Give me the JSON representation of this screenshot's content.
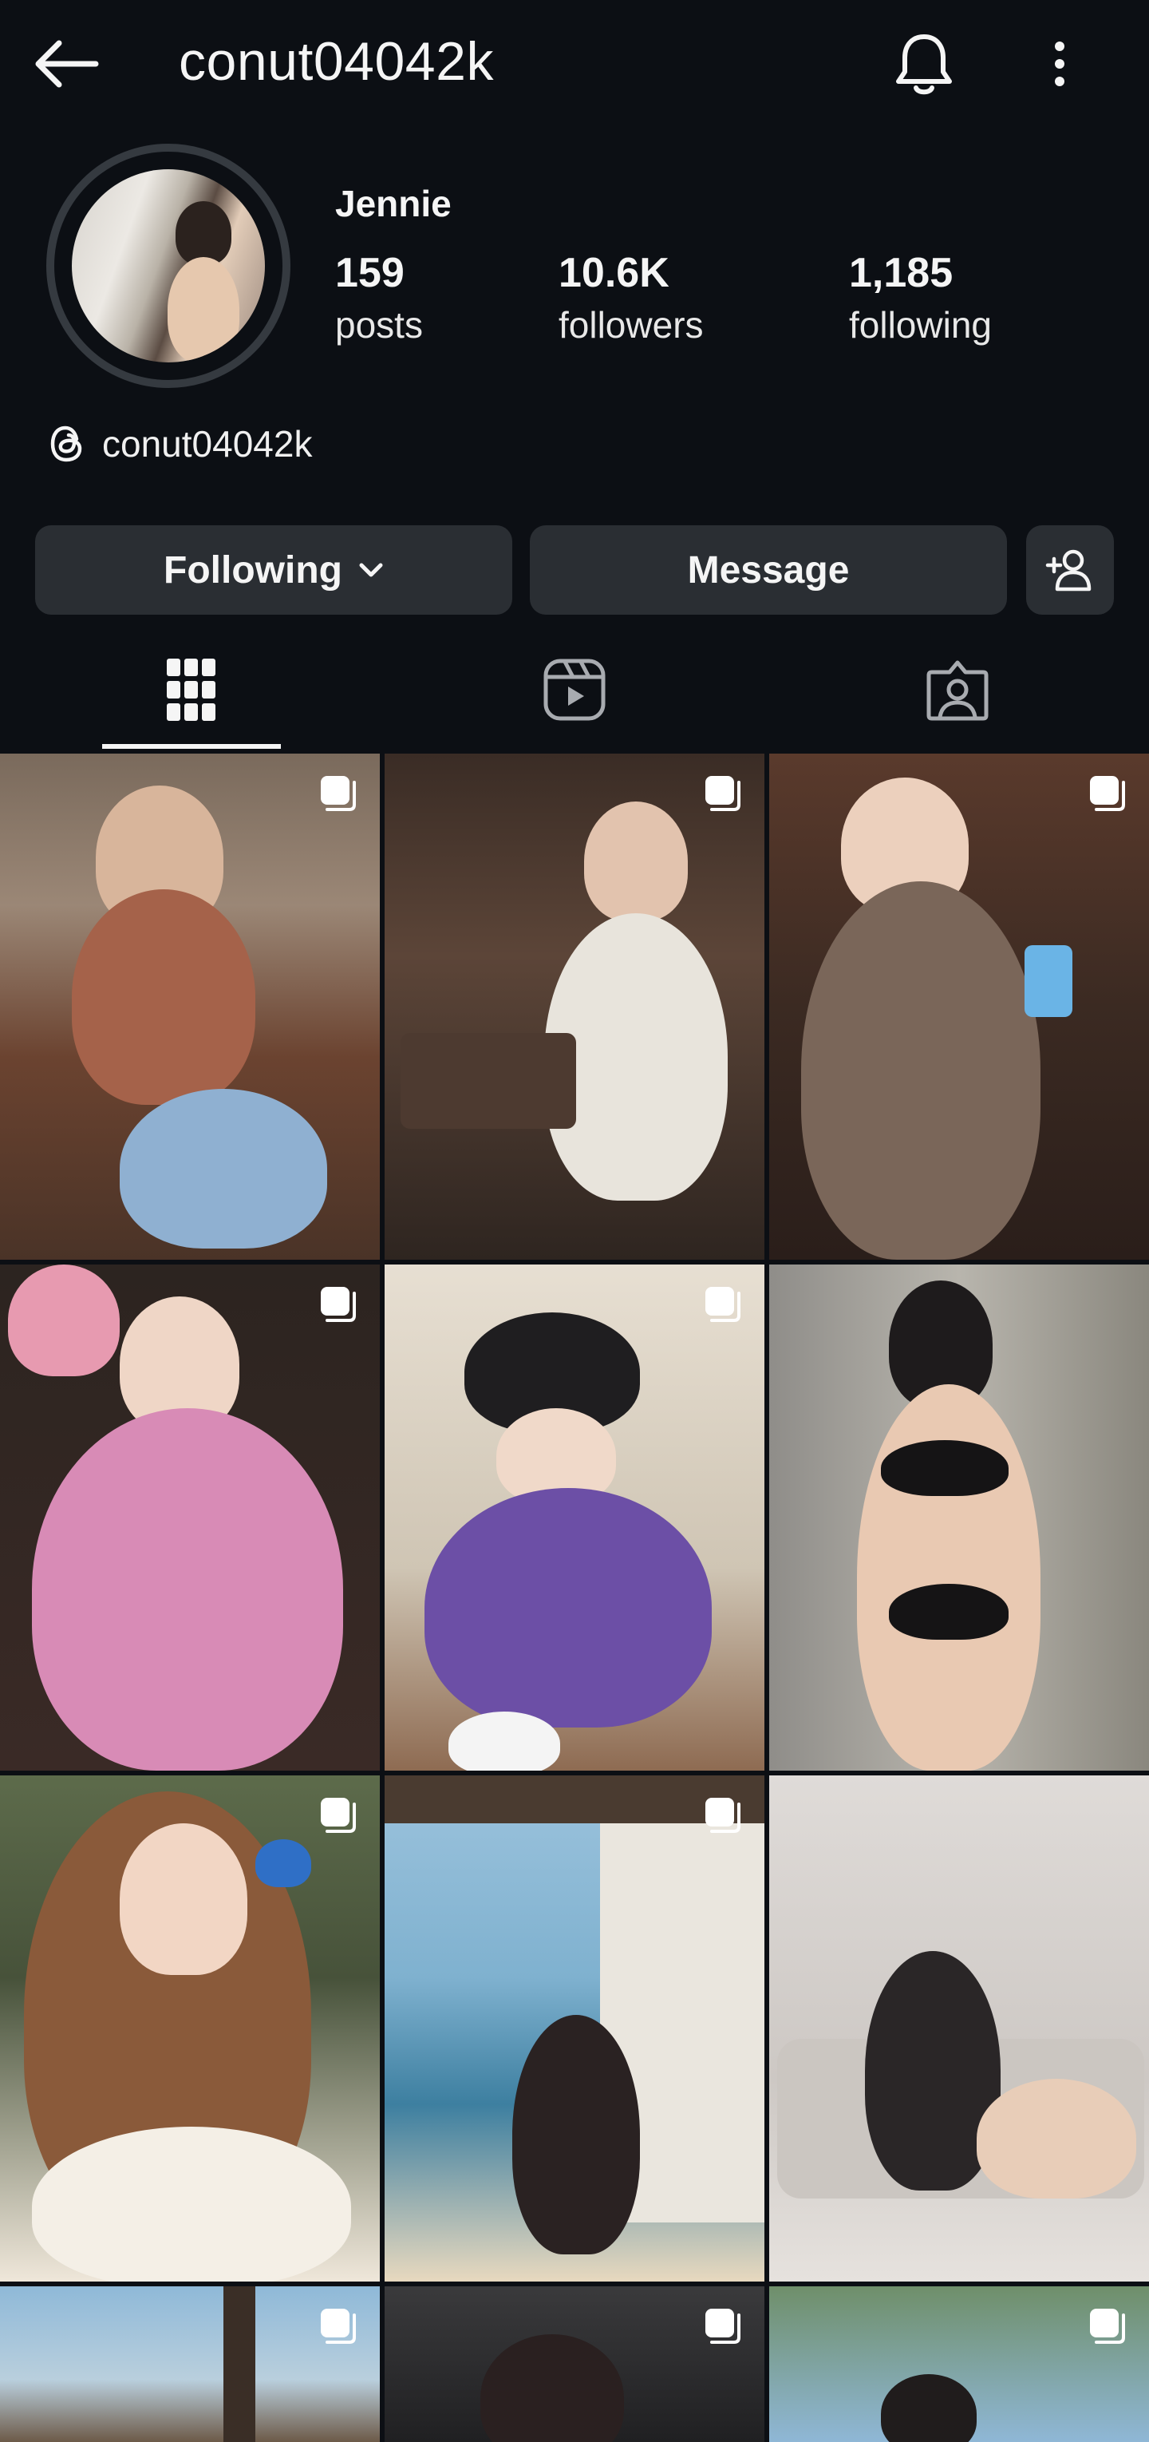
{
  "header": {
    "username": "conut04042k",
    "back_icon": "arrow-left-icon",
    "bell_icon": "bell-icon",
    "more_icon": "more-vertical-icon"
  },
  "profile": {
    "display_name": "Jennie",
    "stats": [
      {
        "count": "159",
        "label": "posts"
      },
      {
        "count": "10.6K",
        "label": "followers"
      },
      {
        "count": "1,185",
        "label": "following"
      }
    ],
    "threads_handle": "conut04042k"
  },
  "actions": {
    "following_label": "Following",
    "message_label": "Message",
    "add_user_icon": "add-user-icon"
  },
  "tabs": [
    {
      "name": "posts-grid",
      "icon": "grid-icon",
      "active": true
    },
    {
      "name": "reels",
      "icon": "reels-icon",
      "active": false
    },
    {
      "name": "tagged",
      "icon": "tagged-icon",
      "active": false
    }
  ],
  "colors": {
    "background": "#0c0f14",
    "button": "#2a2e33",
    "text": "#f5f5f5"
  },
  "posts": [
    {
      "id": 1,
      "multi": true
    },
    {
      "id": 2,
      "multi": true
    },
    {
      "id": 3,
      "multi": true
    },
    {
      "id": 4,
      "multi": true
    },
    {
      "id": 5,
      "multi": true
    },
    {
      "id": 6,
      "multi": false
    },
    {
      "id": 7,
      "multi": true
    },
    {
      "id": 8,
      "multi": true
    },
    {
      "id": 9,
      "multi": false
    },
    {
      "id": 10,
      "multi": true
    },
    {
      "id": 11,
      "multi": true
    },
    {
      "id": 12,
      "multi": true
    }
  ]
}
